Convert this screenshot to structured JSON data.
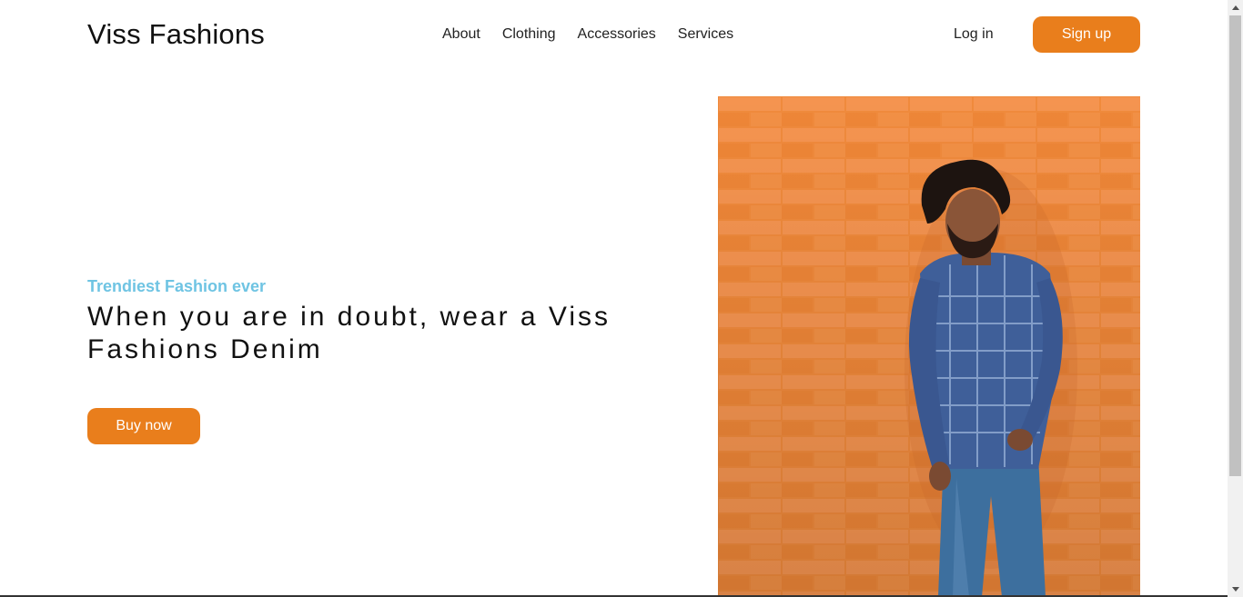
{
  "header": {
    "brand": "Viss Fashions",
    "nav": [
      {
        "label": "About"
      },
      {
        "label": "Clothing"
      },
      {
        "label": "Accessories"
      },
      {
        "label": "Services"
      }
    ],
    "login_label": "Log in",
    "signup_label": "Sign up"
  },
  "hero": {
    "eyebrow": "Trendiest Fashion ever",
    "headline": "When you are in doubt, wear a Viss Fashions Denim",
    "buy_label": "Buy now"
  },
  "colors": {
    "accent": "#e97e1c",
    "eyebrow": "#6fc4e3",
    "brick": "#f08a3c"
  },
  "icons": {
    "scroll_up": "chevron-up-icon",
    "scroll_down": "chevron-down-icon"
  }
}
